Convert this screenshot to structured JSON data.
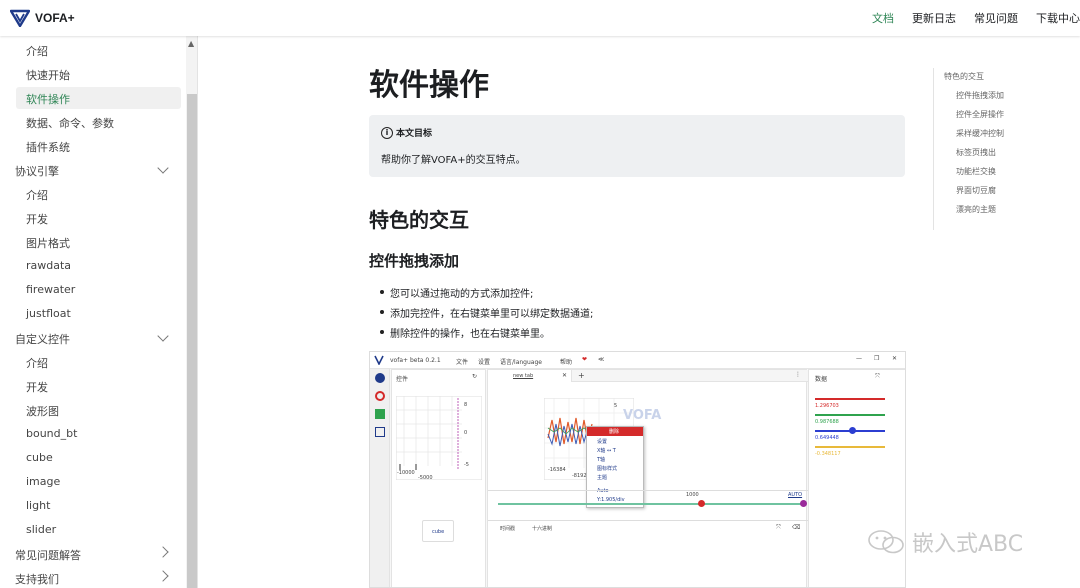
{
  "header": {
    "logo_text": "VOFA+",
    "nav": [
      "文档",
      "更新日志",
      "常见问题",
      "下载中心"
    ]
  },
  "sidebar": {
    "items": [
      {
        "label": "介绍",
        "kind": "item"
      },
      {
        "label": "快速开始",
        "kind": "item"
      },
      {
        "label": "软件操作",
        "kind": "item",
        "active": true
      },
      {
        "label": "数据、命令、参数",
        "kind": "item"
      },
      {
        "label": "插件系统",
        "kind": "item"
      },
      {
        "label": "协议引擎",
        "kind": "category",
        "expanded": true
      },
      {
        "label": "介绍",
        "kind": "item"
      },
      {
        "label": "开发",
        "kind": "item"
      },
      {
        "label": "图片格式",
        "kind": "item"
      },
      {
        "label": "rawdata",
        "kind": "item"
      },
      {
        "label": "firewater",
        "kind": "item"
      },
      {
        "label": "justfloat",
        "kind": "item"
      },
      {
        "label": "自定义控件",
        "kind": "category",
        "expanded": true
      },
      {
        "label": "介绍",
        "kind": "item"
      },
      {
        "label": "开发",
        "kind": "item"
      },
      {
        "label": "波形图",
        "kind": "item"
      },
      {
        "label": "bound_bt",
        "kind": "item"
      },
      {
        "label": "cube",
        "kind": "item"
      },
      {
        "label": "image",
        "kind": "item"
      },
      {
        "label": "light",
        "kind": "item"
      },
      {
        "label": "slider",
        "kind": "item"
      },
      {
        "label": "常见问题解答",
        "kind": "category",
        "expanded": false
      },
      {
        "label": "支持我们",
        "kind": "category",
        "expanded": false
      }
    ]
  },
  "main": {
    "title": "软件操作",
    "admonition": {
      "title": "本文目标",
      "body": "帮助你了解VOFA+的交互特点。"
    },
    "h2": "特色的交互",
    "h3": "控件拖拽添加",
    "bullets": [
      "您可以通过拖动的方式添加控件;",
      "添加完控件，在右键菜单里可以绑定数据通道;",
      "删除控件的操作，也在右键菜单里。"
    ]
  },
  "toc": {
    "items": [
      "特色的交互",
      "控件拖拽添加",
      "控件全屏操作",
      "采样缓冲控制",
      "标签页拽出",
      "功能栏交换",
      "界面切豆腐",
      "漂亮的主题"
    ]
  },
  "screenshot": {
    "title": "vofa+ beta 0.2.1",
    "menu": [
      "文件",
      "设置",
      "语言/language",
      "帮助"
    ],
    "left_panel_title": "控件",
    "tab_label": "new tab",
    "right_panel_title": "数据",
    "values": [
      "1.296703",
      "0.987688",
      "0.649448",
      "-0.348117"
    ],
    "ticks": [
      "8",
      "0",
      "-5",
      "-10000",
      "-5000",
      "-16384",
      "-8192",
      "5"
    ],
    "ctx_menu": [
      "删除",
      "设置",
      "X轴 ↔ T",
      "T轴",
      "图标样式",
      "主题",
      "Auto",
      "Y:1.905/div"
    ],
    "bottom_bar": {
      "auto": "AUTO",
      "value": "1000"
    },
    "footer": [
      "时间戳",
      "十六进制"
    ],
    "cube_label": "cube",
    "logo_text": "VOFA"
  },
  "watermark": {
    "text": "嵌入式ABC"
  },
  "colors": {
    "accent": "#2e8555",
    "logo_blue": "#1f3a8a",
    "menu_red": "#d42a2a"
  }
}
